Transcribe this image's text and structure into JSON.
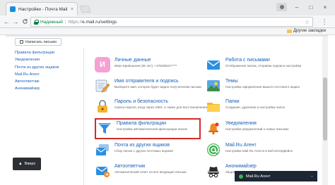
{
  "browser": {
    "tab_title": "Настройки - Почта Mail.Ru",
    "close_tab": "×",
    "window_controls": {
      "minimize": "–",
      "maximize": "□",
      "close": "×"
    },
    "nav": {
      "back": "←",
      "forward": "→",
      "reload": "C"
    },
    "secure_label": "Надежный",
    "separator": "|",
    "url_scheme": "https://",
    "url_rest": "e.mail.ru/settings",
    "other_bookmarks": "Другие закладки"
  },
  "page": {
    "compose_label": "Написать письмо",
    "sidebar": [
      "Правила фильтрации",
      "Уведомления",
      "Почта из других ящиков",
      "Mail.Ru Агент",
      "Автоответчик",
      "Анонимайзер"
    ],
    "back_label": "Вверх",
    "agent_label": "Mail.Ru Агент",
    "agent_minimize": "–",
    "items": [
      {
        "title": "Личные данные",
        "desc": "Иван Кривошеев (36 лет), +37529621*****",
        "icon": "avatar-initial-icon",
        "initial": "И"
      },
      {
        "title": "Работа с письмами",
        "desc": "Отображение писем, отправка подписи настройки",
        "icon": "envelope-icon"
      },
      {
        "title": "Имя отправителя и подпись",
        "desc": "Выберите имя, которое будет видно получателям письма",
        "icon": "signature-pen-icon"
      },
      {
        "title": "Темы",
        "desc": "Настройка оформления вашего почтового ящика",
        "icon": "theme-picture-icon"
      },
      {
        "title": "Пароль и безопасность",
        "desc": "Смена пароля, вход через SMS, а также для восстановления",
        "icon": "padlock-icon"
      },
      {
        "title": "Папки",
        "desc": "Создание, удаление и настройка папок",
        "icon": "folder-icon"
      },
      {
        "title": "Правила фильтрации",
        "desc": "Настройка автоматической фильтрации писем",
        "icon": "filter-funnel-icon"
      },
      {
        "title": "Уведомления",
        "desc": "Настройка уведомлений о новых письмах",
        "icon": "bell-icon"
      },
      {
        "title": "Почта из других ящиков",
        "desc": "Сбор писем с других почтовых ящиков",
        "icon": "mailboxes-icon"
      },
      {
        "title": "Mail.Ru Агент",
        "desc": "Настройка Mail.Ru Агента в веб-интерфейсе",
        "icon": "agent-at-icon"
      },
      {
        "title": "Автоответчик",
        "desc": "Автоматический ответ на все входящие письма",
        "icon": "autoreply-icon"
      },
      {
        "title": "Анонимайзер",
        "desc": "Защита адреса от спама",
        "icon": "spy-hat-icon"
      }
    ]
  },
  "colors": {
    "link": "#1a5fb4",
    "secure": "#0b8043",
    "highlight": "#d22a2a"
  }
}
